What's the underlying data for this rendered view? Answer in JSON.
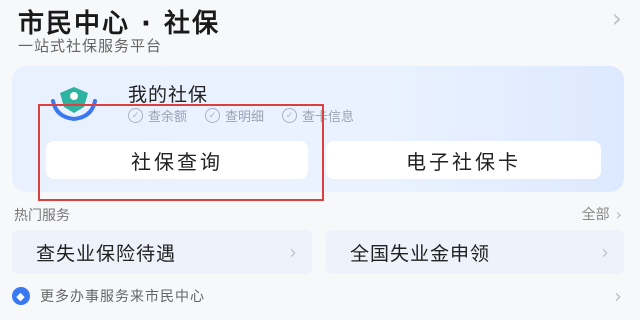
{
  "header": {
    "title": "市民中心 · 社保",
    "subtitle": "一站式社保服务平台",
    "chevron_icon": "chevron-right-icon"
  },
  "card": {
    "title": "我的社保",
    "logo_icon": "social-security-logo",
    "links": [
      {
        "label": "查余额"
      },
      {
        "label": "查明细"
      },
      {
        "label": "查卡信息"
      }
    ],
    "buttons": {
      "query": "社保查询",
      "ecard": "电子社保卡"
    },
    "highlight_color": "#d9403f"
  },
  "hot_services": {
    "title": "热门服务",
    "all": "全部",
    "items": [
      {
        "label": "查失业保险待遇"
      },
      {
        "label": "全国失业金申领"
      }
    ]
  },
  "footer": {
    "text": "更多办事服务来市民中心"
  },
  "colors": {
    "accent": "#3a78f2",
    "card_bg": "#e9f1ff"
  }
}
